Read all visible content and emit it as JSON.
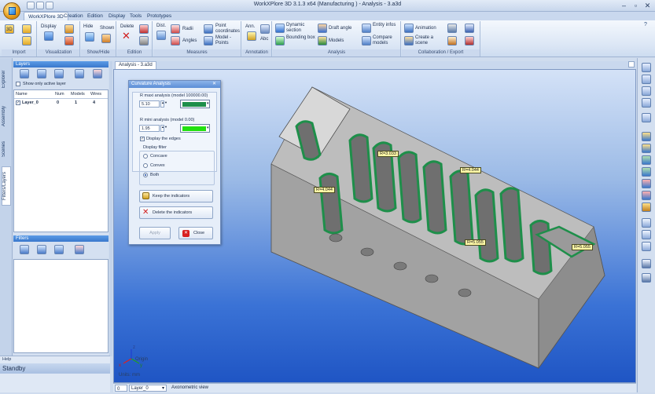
{
  "window": {
    "title": "WorkXPlore 3D 3.1.3 x64 (Manufacturing ) - Analysis - 3.a3d"
  },
  "tabs": [
    "WorkXPlore 3D",
    "Creation",
    "Edition",
    "Display",
    "Tools",
    "Prototypes"
  ],
  "ribbon": {
    "groups": [
      {
        "label": "Import",
        "buttons": [
          "3D",
          ""
        ]
      },
      {
        "label": "Visualization",
        "buttons": [
          "Display"
        ]
      },
      {
        "label": "Show/Hide",
        "buttons": [
          "Hide",
          "Shown"
        ]
      },
      {
        "label": "Edition",
        "buttons": [
          "Delete"
        ]
      },
      {
        "label": "Measures",
        "buttons": [
          "Dist.",
          "Radii",
          "Angles",
          "Point coordinates",
          "Model - Points"
        ]
      },
      {
        "label": "Annotation",
        "buttons": [
          "Ann.",
          "Abc"
        ]
      },
      {
        "label": "Analysis",
        "buttons": [
          "Dynamic section",
          "Bounding box",
          "Draft angle",
          "Models",
          "Entity infos",
          "Compare models"
        ]
      },
      {
        "label": "Collaboration / Export",
        "buttons": [
          "Animation",
          "Create a scene"
        ]
      }
    ]
  },
  "left_tabs": [
    "Explorer",
    "Assembly",
    "Scenes",
    "Filters/Layers"
  ],
  "layers": {
    "title": "Layers",
    "show_only_active": "Show only active layer",
    "columns": [
      "Name",
      "Num",
      "Models",
      "Wires"
    ],
    "rows": [
      {
        "name": "Layer_0",
        "num": "0",
        "models": "1",
        "wires": "4"
      }
    ]
  },
  "filters": {
    "title": "Filters"
  },
  "help": {
    "title": "Help",
    "status": "Standby"
  },
  "document": {
    "tab": "Analysis - 3.a3d"
  },
  "dialog": {
    "title": "Curvature Analysis",
    "rmax_label": "R maxi analysis  (model 100000.00)",
    "rmax_value": "5.10",
    "rmin_label": "R mini analysis  (model 0.00)",
    "rmin_value": "1.95",
    "display_edges": "Display the edges",
    "filter_title": "Display filter",
    "concave": "Concave",
    "convex": "Convex",
    "both": "Both",
    "keep": "Keep the indicators",
    "delete": "Delete the indicators",
    "apply": "Apply",
    "close": "Close",
    "color_max": "#1e8f4a",
    "color_min": "#22e010"
  },
  "annotations": [
    "R=3.033",
    "R=4.044",
    "R=4.044",
    "R=5.055",
    "R=5.055"
  ],
  "axes": {
    "origin": "Origin",
    "units": "Units: mm",
    "x": "x",
    "y": "y",
    "z": "z"
  },
  "statusbar": {
    "field1": "0",
    "layer": "Layer_0",
    "view": "Axonometric view"
  }
}
